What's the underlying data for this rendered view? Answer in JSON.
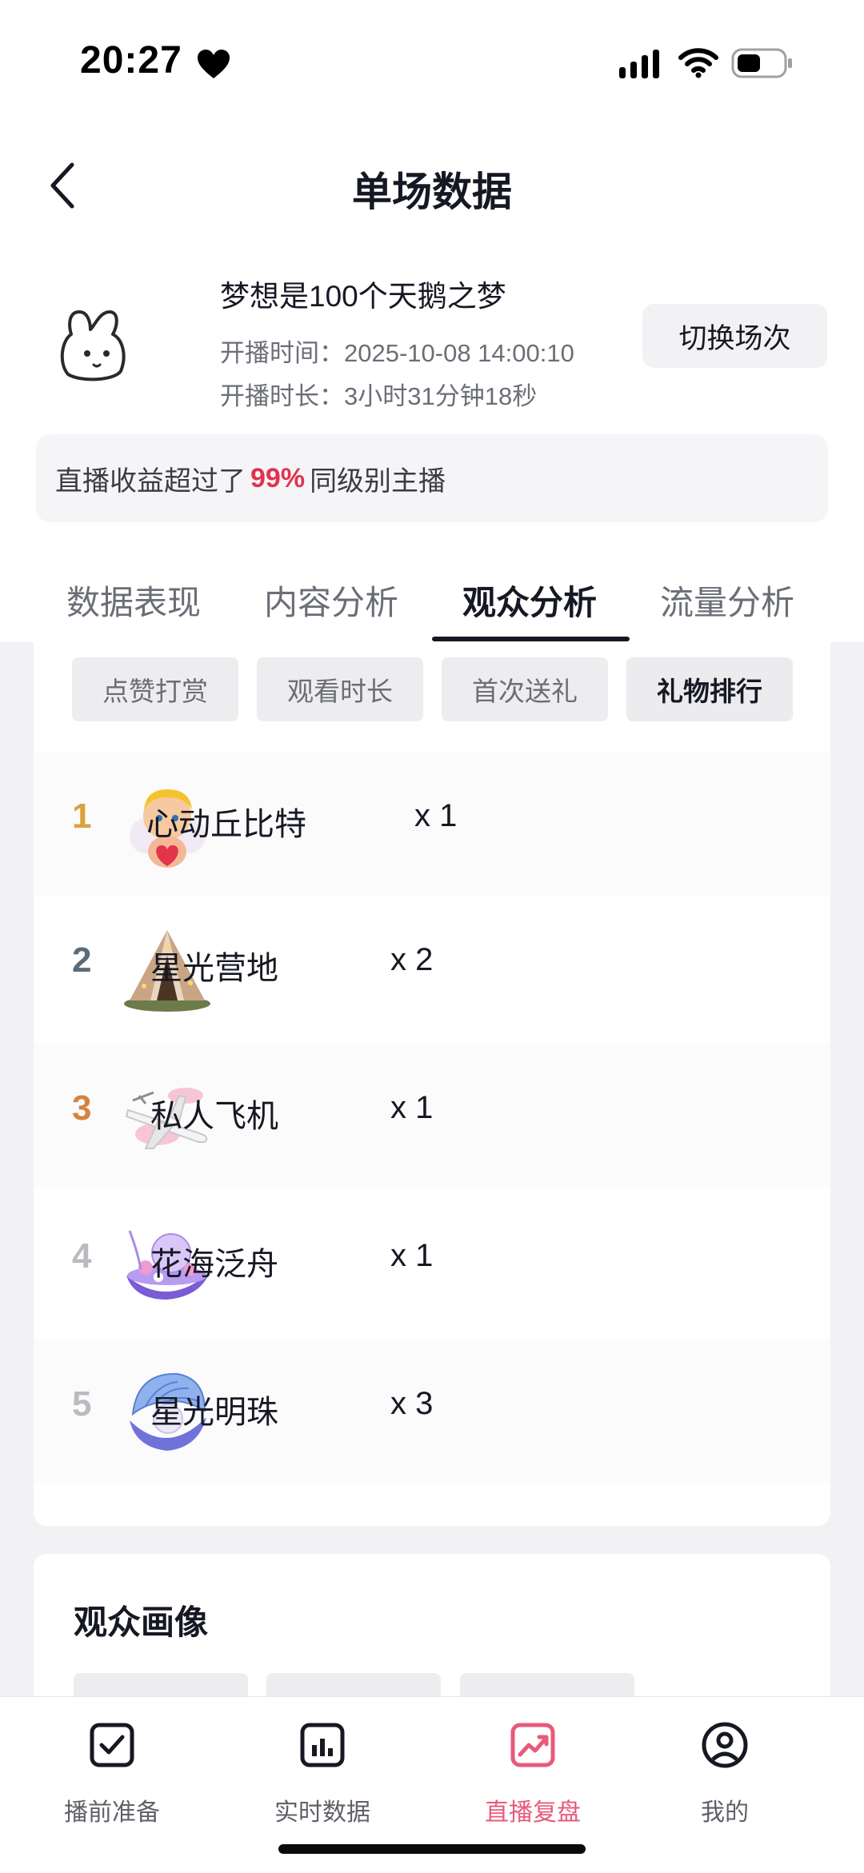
{
  "status_bar": {
    "time": "20:27"
  },
  "nav": {
    "title": "单场数据",
    "back_icon": "chevron-left-icon"
  },
  "session": {
    "name": "梦想是100个天鹅之梦",
    "start_time": "开播时间：2025-10-08 14:00:10",
    "duration": "开播时长：3小时31分钟18秒",
    "switch_label": "切换场次"
  },
  "banner": {
    "prefix": "直播收益超过了",
    "percent": "99%",
    "suffix": "同级别主播",
    "accent": "#e0334f"
  },
  "tabs": [
    {
      "label": "数据表现"
    },
    {
      "label": "内容分析"
    },
    {
      "label": "观众分析",
      "active": true
    },
    {
      "label": "流量分析"
    }
  ],
  "chips": [
    {
      "label": "点赞打赏"
    },
    {
      "label": "观看时长"
    },
    {
      "label": "首次送礼"
    },
    {
      "label": "礼物排行",
      "active": true
    }
  ],
  "gift_ranking": [
    {
      "rank": "1",
      "name": "心动丘比特",
      "count": "x 1",
      "rank_color": "#d9a23e",
      "icon": "cupid-icon"
    },
    {
      "rank": "2",
      "name": "星光营地",
      "count": "x 2",
      "rank_color": "#5b6b78",
      "icon": "tent-icon"
    },
    {
      "rank": "3",
      "name": "私人飞机",
      "count": "x 1",
      "rank_color": "#d4843e",
      "icon": "airplane-icon"
    },
    {
      "rank": "4",
      "name": "花海泛舟",
      "count": "x 1",
      "rank_color": "#b9bbc0",
      "icon": "flower-boat-icon"
    },
    {
      "rank": "5",
      "name": "星光明珠",
      "count": "x 3",
      "rank_color": "#b9bbc0",
      "icon": "pearl-shell-icon"
    }
  ],
  "audience_portrait": {
    "title": "观众画像"
  },
  "tabbar": [
    {
      "label": "播前准备",
      "icon": "checkbox-icon"
    },
    {
      "label": "实时数据",
      "icon": "bar-chart-icon"
    },
    {
      "label": "直播复盘",
      "icon": "trend-icon",
      "active": true,
      "color": "#e85a7a"
    },
    {
      "label": "我的",
      "icon": "profile-icon"
    }
  ]
}
